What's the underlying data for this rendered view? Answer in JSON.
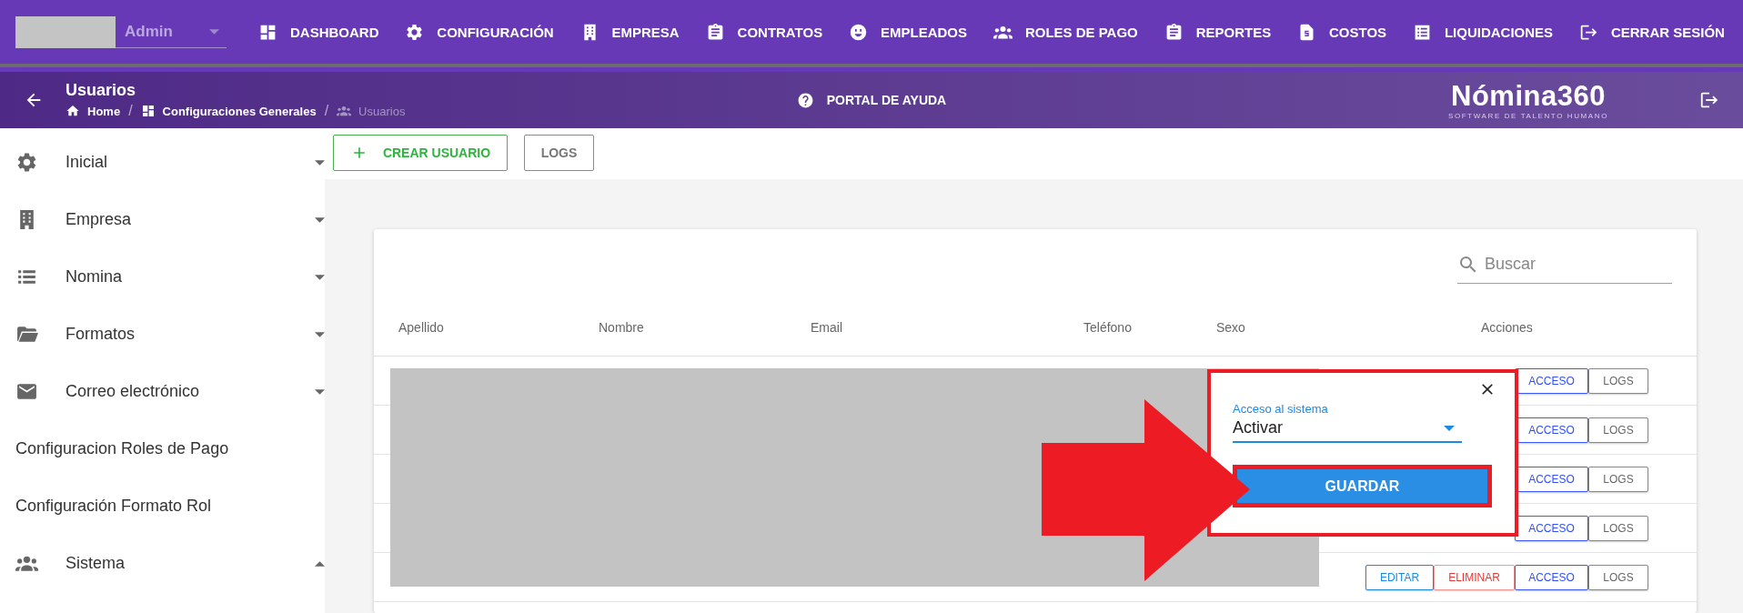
{
  "user_menu": {
    "name": "Admin"
  },
  "nav": [
    {
      "label": "DASHBOARD"
    },
    {
      "label": "CONFIGURACIÓN"
    },
    {
      "label": "EMPRESA"
    },
    {
      "label": "CONTRATOS"
    },
    {
      "label": "EMPLEADOS"
    },
    {
      "label": "ROLES DE PAGO"
    },
    {
      "label": "REPORTES"
    },
    {
      "label": "COSTOS"
    },
    {
      "label": "LIQUIDACIONES"
    },
    {
      "label": "CERRAR SESIÓN"
    }
  ],
  "header": {
    "title": "Usuarios",
    "breadcrumb": [
      {
        "label": "Home",
        "current": false
      },
      {
        "separator": "/",
        "label": "Configuraciones Generales",
        "current": false
      },
      {
        "separator": "/",
        "label": "Usuarios",
        "current": true
      }
    ],
    "help": "PORTAL DE AYUDA",
    "logo": {
      "name": "Nómina360",
      "tagline": "SOFTWARE DE TALENTO HUMANO"
    }
  },
  "sidebar": {
    "items": [
      {
        "label": "Inicial",
        "kind": "group",
        "expanded": false
      },
      {
        "label": "Empresa",
        "kind": "group",
        "expanded": false
      },
      {
        "label": "Nomina",
        "kind": "group",
        "expanded": false
      },
      {
        "label": "Formatos",
        "kind": "group",
        "expanded": false
      },
      {
        "label": "Correo electrónico",
        "kind": "group",
        "expanded": false
      },
      {
        "label": "Configuracion Roles de Pago",
        "kind": "link"
      },
      {
        "label": "Configuración Formato Rol",
        "kind": "link"
      },
      {
        "label": "Sistema",
        "kind": "group",
        "expanded": true
      }
    ]
  },
  "toolbar": {
    "buttons": [
      {
        "label": "CREAR USUARIO",
        "kind": "create"
      },
      {
        "label": "LOGS",
        "kind": "plain"
      }
    ]
  },
  "table": {
    "search": {
      "placeholder": "Buscar"
    },
    "columns": [
      "Apellido",
      "Nombre",
      "Email",
      "Teléfono",
      "Sexo",
      "Acciones"
    ],
    "rows": [
      {
        "actions": [
          {
            "label": "ACCESO",
            "kind": "access"
          },
          {
            "label": "LOGS",
            "kind": "logs"
          }
        ]
      },
      {
        "actions": [
          {
            "label": "ACCESO",
            "kind": "access"
          },
          {
            "label": "LOGS",
            "kind": "logs"
          }
        ]
      },
      {
        "actions": [
          {
            "label": "ACCESO",
            "kind": "access"
          },
          {
            "label": "LOGS",
            "kind": "logs"
          }
        ]
      },
      {
        "actions": [
          {
            "label": "ACCESO",
            "kind": "access"
          },
          {
            "label": "LOGS",
            "kind": "logs"
          }
        ]
      },
      {
        "actions": [
          {
            "label": "EDITAR",
            "kind": "edit"
          },
          {
            "label": "ELIMINAR",
            "kind": "delete"
          },
          {
            "label": "ACCESO",
            "kind": "access"
          },
          {
            "label": "LOGS",
            "kind": "logs"
          }
        ]
      }
    ]
  },
  "popup": {
    "field_label": "Acceso al sistema",
    "value": "Activar",
    "button": "GUARDAR"
  }
}
